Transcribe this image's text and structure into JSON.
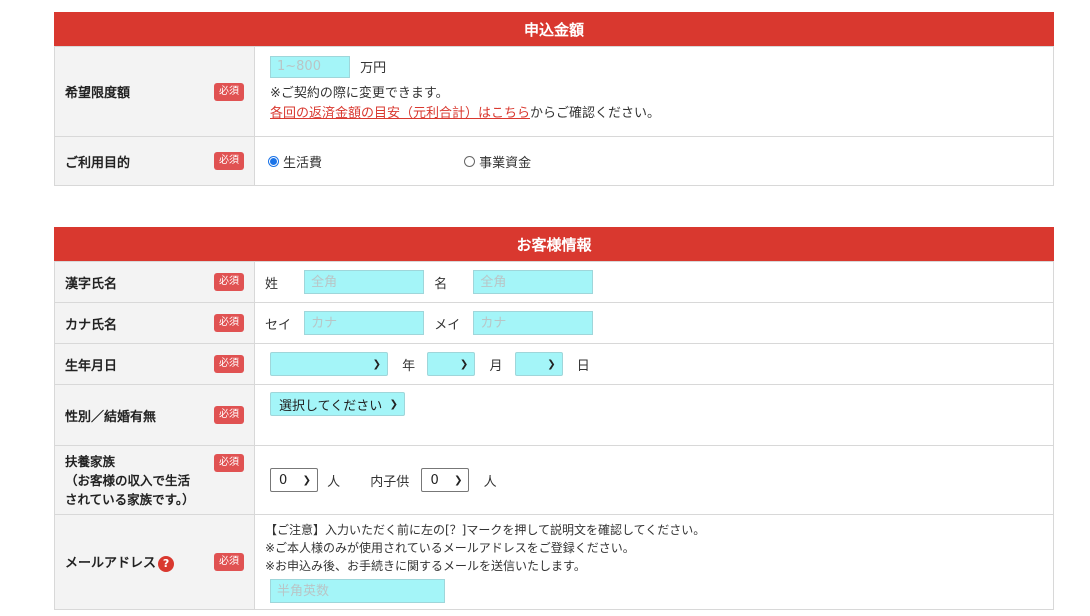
{
  "sections": {
    "amount": {
      "title": "申込金額",
      "rows": {
        "limit": {
          "label": "希望限度額",
          "required": "必須",
          "placeholder": "1~800",
          "unit": "万円",
          "note": "※ご契約の際に変更できます。",
          "link_text": "各回の返済金額の目安（元利合計）はこちら",
          "link_suffix": "からご確認ください。"
        },
        "purpose": {
          "label": "ご利用目的",
          "required": "必須",
          "options": [
            "生活費",
            "事業資金"
          ],
          "selected": "生活費"
        }
      }
    },
    "customer": {
      "title": "お客様情報",
      "rows": {
        "kanji_name": {
          "label": "漢字氏名",
          "required": "必須",
          "last_label": "姓",
          "first_label": "名",
          "placeholder": "全角"
        },
        "kana_name": {
          "label": "カナ氏名",
          "required": "必須",
          "last_label": "セイ",
          "first_label": "メイ",
          "placeholder": "カナ"
        },
        "birthdate": {
          "label": "生年月日",
          "required": "必須",
          "year_label": "年",
          "month_label": "月",
          "day_label": "日"
        },
        "gender_marital": {
          "label": "性別／結婚有無",
          "required": "必須",
          "select_value": "選択してください"
        },
        "dependents": {
          "label_line1": "扶養家族",
          "label_line2": "（お客様の収入で生活",
          "label_line3": "されている家族です。）",
          "required": "必須",
          "count_value": "0",
          "unit": "人",
          "children_label": "内子供",
          "children_value": "0",
          "children_unit": "人"
        },
        "email": {
          "label": "メールアドレス",
          "help_icon": "?",
          "required": "必須",
          "note1": "【ご注意】入力いただく前に左の[？]マークを押して説明文を確認してください。",
          "note2": "※ご本人様のみが使用されているメールアドレスをご登録ください。",
          "note3": "※お申込み後、お手続きに関するメールを送信いたします。",
          "placeholder": "半角英数"
        }
      }
    }
  },
  "colors": {
    "header": "#d9382f",
    "required_badge": "#e05252",
    "input_bg": "#a4f5f8",
    "label_bg": "#f3f3f3"
  }
}
